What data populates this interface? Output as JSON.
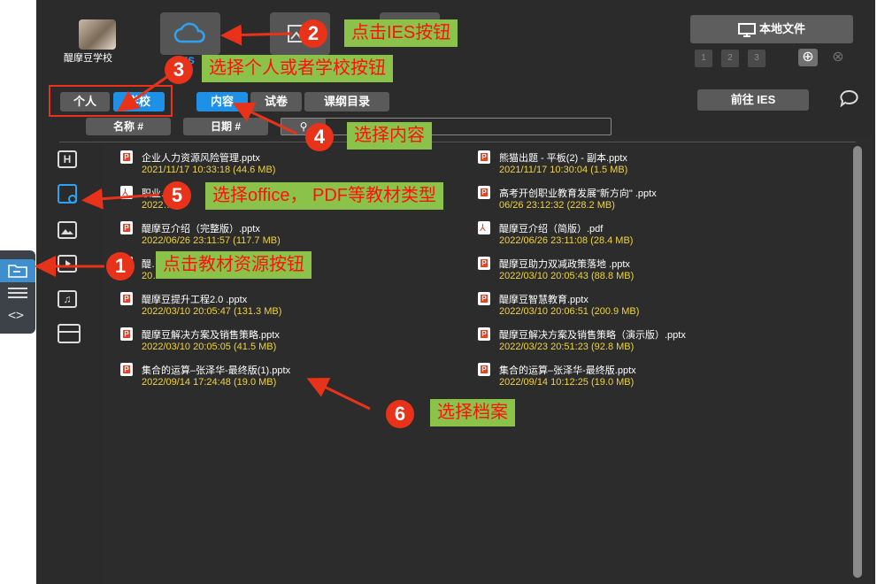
{
  "header": {
    "school_name": "醍摩豆学校",
    "ies_label": "IES",
    "local_file_label": "本地文件",
    "pages": [
      "1",
      "2",
      "3"
    ]
  },
  "toolbar": {
    "personal_label": "个人",
    "school_label": "学校",
    "tabs": [
      "内容",
      "试卷",
      "课纲目录"
    ],
    "goto_ies_label": "前往 IES",
    "sort_name_label": "名称 #",
    "sort_date_label": "日期 #",
    "search_placeholder": ""
  },
  "files_left": [
    {
      "name": "企业人力资源风险管理.pptx",
      "meta": "2021/11/17 10:33:18 (44.6 MB)",
      "type": "ppt"
    },
    {
      "name": "职业…",
      "meta": "2022…26",
      "type": "pdf"
    },
    {
      "name": "醍摩豆介绍（完整版）.pptx",
      "meta": "2022/06/26 23:11:57 (117.7 MB)",
      "type": "ppt"
    },
    {
      "name": "醍…",
      "meta": "20…",
      "type": "ppt"
    },
    {
      "name": "醍摩豆提升工程2.0 .pptx",
      "meta": "2022/03/10 20:05:47 (131.3 MB)",
      "type": "ppt"
    },
    {
      "name": "醍摩豆解决方案及销售策略.pptx",
      "meta": "2022/03/10 20:05:05 (41.5 MB)",
      "type": "ppt"
    },
    {
      "name": "集合的运算–张泽华-最终版(1).pptx",
      "meta": "2022/09/14 17:24:48 (19.0 MB)",
      "type": "ppt"
    }
  ],
  "files_right": [
    {
      "name": "熊猫出题 - 平板(2) - 副本.pptx",
      "meta": "2021/11/17 10:30:04 (1.5 MB)",
      "type": "ppt"
    },
    {
      "name": "高考开创职业教育发展\"新方向\" .pptx",
      "meta": "06/26 23:12:32 (228.2 MB)",
      "type": "ppt"
    },
    {
      "name": "醍摩豆介绍（简版）.pdf",
      "meta": "2022/06/26 23:11:08 (28.4 MB)",
      "type": "pdf"
    },
    {
      "name": "醍摩豆助力双减政策落地 .pptx",
      "meta": "2022/03/10 20:05:43 (88.8 MB)",
      "type": "ppt"
    },
    {
      "name": "醍摩豆智慧教育.pptx",
      "meta": "2022/03/10 20:06:51 (200.9 MB)",
      "type": "ppt"
    },
    {
      "name": "醍摩豆解决方案及销售策略（演示版）.pptx",
      "meta": "2022/03/23 20:51:23 (92.8 MB)",
      "type": "ppt"
    },
    {
      "name": "集合的运算–张泽华-最终版.pptx",
      "meta": "2022/09/14 10:12:25 (19.0 MB)",
      "type": "ppt"
    }
  ],
  "annotations": [
    {
      "num": "1",
      "text": "点击教材资源按钮"
    },
    {
      "num": "2",
      "text": "点击IES按钮"
    },
    {
      "num": "3",
      "text": "选择个人或者学校按钮"
    },
    {
      "num": "4",
      "text": "选择内容"
    },
    {
      "num": "5",
      "text": "选择office， PDF等教材类型"
    },
    {
      "num": "6",
      "text": "选择档案"
    }
  ],
  "colors": {
    "panel": "#2b2b2b",
    "accent": "#1e90e6",
    "meta_yellow": "#f0d43a",
    "callout_green": "#8bc34a",
    "callout_red": "#e8331a"
  }
}
